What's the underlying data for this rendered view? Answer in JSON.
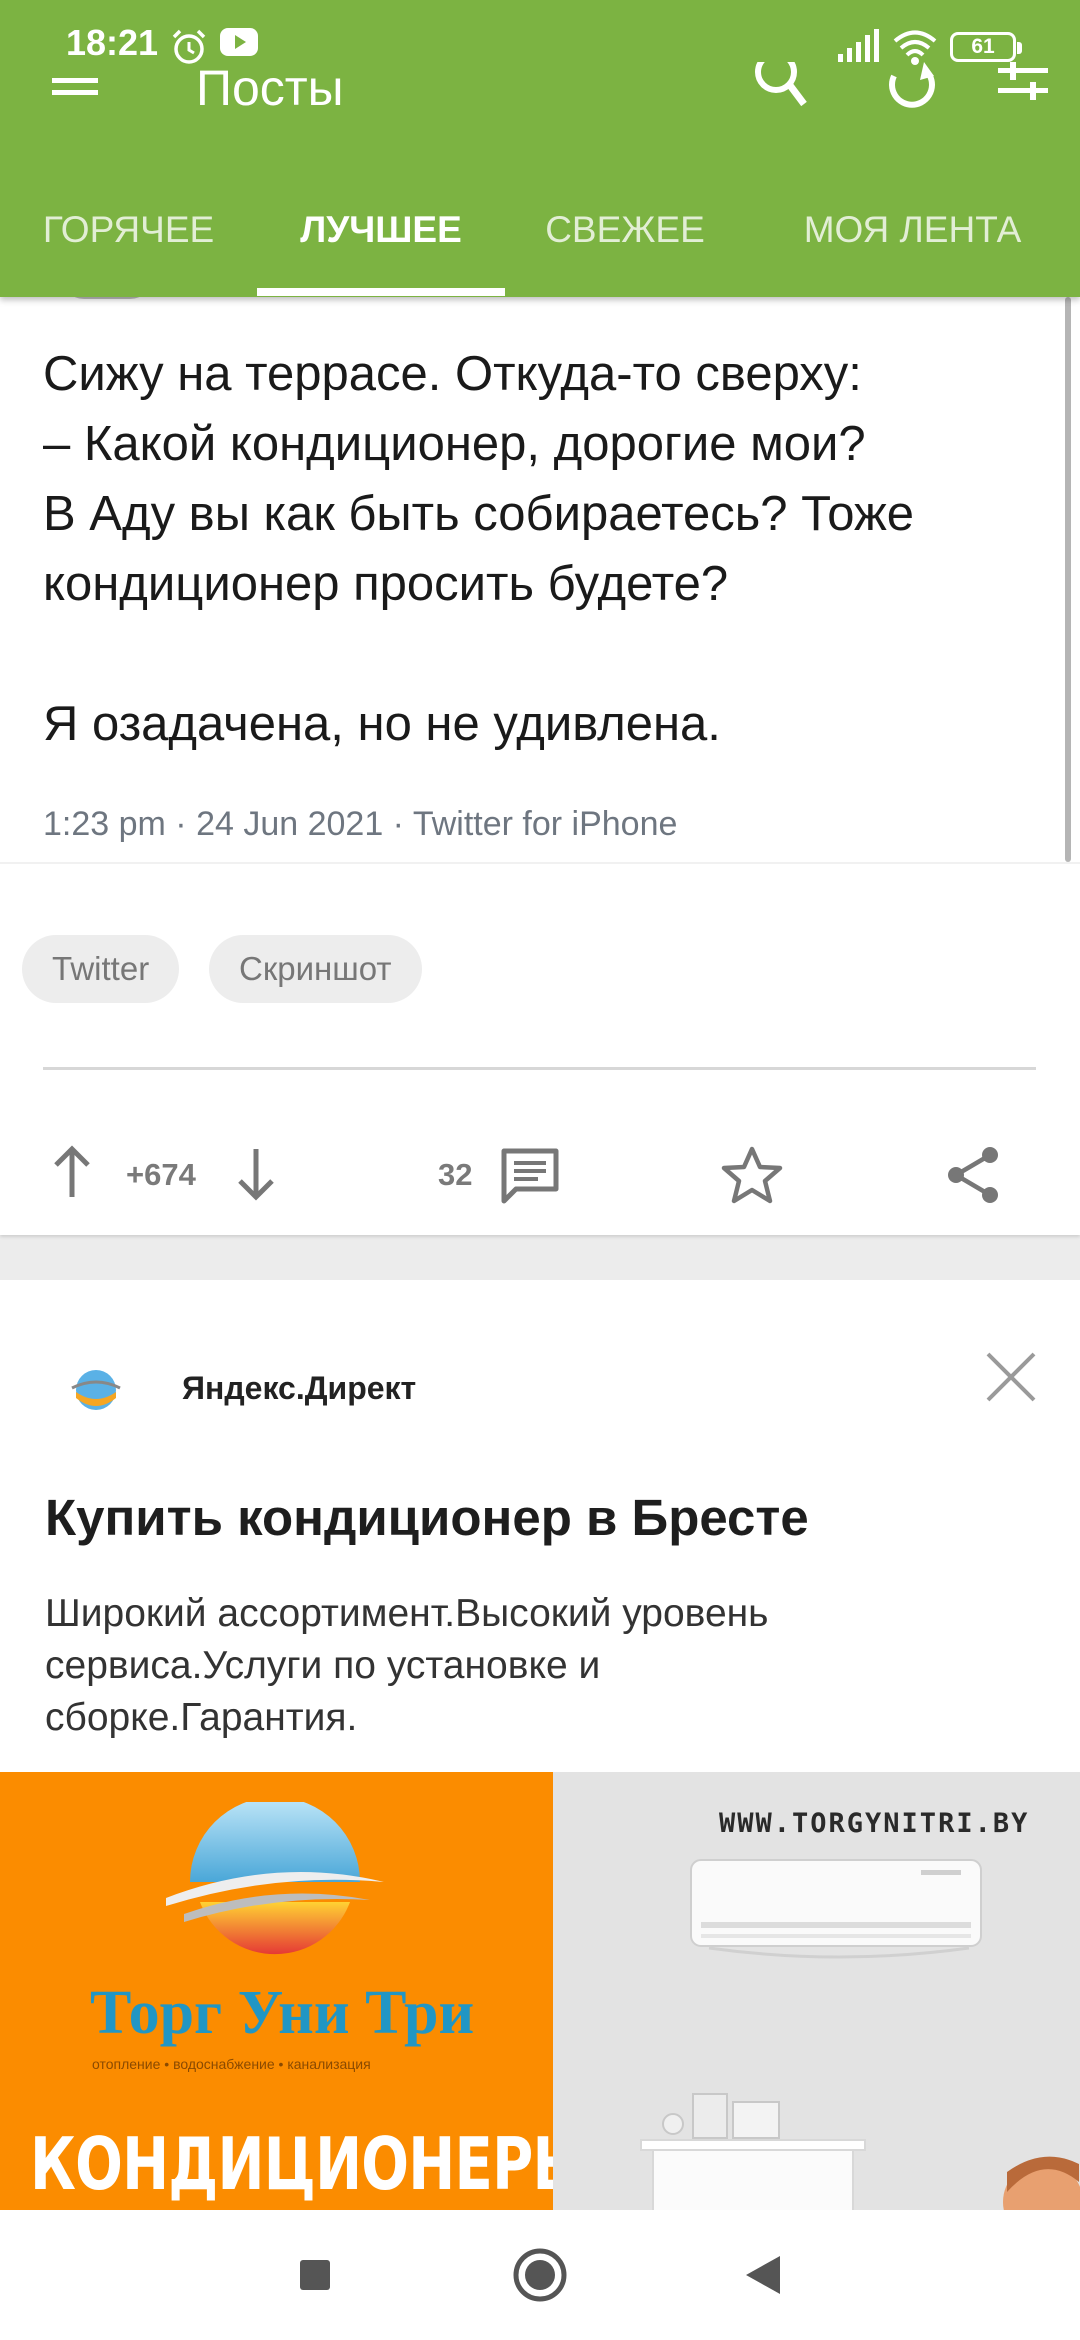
{
  "status_bar": {
    "time": "18:21",
    "battery": "61",
    "icons": [
      "alarm-icon",
      "youtube-icon",
      "signal-icon",
      "wifi-icon",
      "battery-icon"
    ]
  },
  "toolbar": {
    "title": "Посты",
    "icons": [
      "menu-icon",
      "search-icon",
      "refresh-icon",
      "filter-icon"
    ]
  },
  "tabs": [
    {
      "label": "ГОРЯЧЕЕ",
      "active": false
    },
    {
      "label": "ЛУЧШЕЕ",
      "active": true
    },
    {
      "label": "СВЕЖЕЕ",
      "active": false
    },
    {
      "label": "МОЯ ЛЕНТА",
      "active": false
    }
  ],
  "post": {
    "tweet_text": "Сижу на террасе. Откуда-то сверху:\n– Какой кондиционер, дорогие мои?\nВ Аду вы как быть собираетесь? Тоже\nкондиционер просить будете?\n\nЯ озадачена, но не удивлена.",
    "tweet_meta": "1:23 pm · 24 Jun 2021 · Twitter for iPhone",
    "tags": [
      "Twitter",
      "Скриншот"
    ],
    "score": "+674",
    "comments": "32"
  },
  "ad": {
    "source": "Яндекс.Директ",
    "title": "Купить кондиционер в Бресте",
    "description": "Широкий ассортимент.Высокий уровень сервиса.Услуги по установке и сборке.Гарантия.",
    "banner": {
      "brand": "Торг Уни Три",
      "brand_tagline": "отопление • водоснабжение • канализация",
      "headline": "КОНДИЦИОНЕРЫ",
      "url": "WWW.TORGYNITRI.BY"
    }
  },
  "colors": {
    "appbar": "#7cb342",
    "banner_orange": "#fb8c00"
  }
}
